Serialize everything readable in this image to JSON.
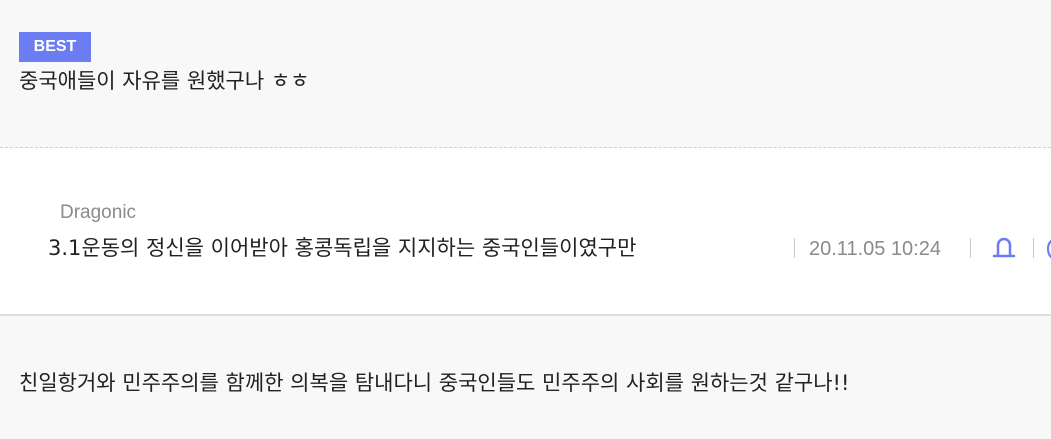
{
  "best_comment": {
    "badge": "BEST",
    "text": "중국애들이 자유를 원했구나 ㅎㅎ"
  },
  "reply": {
    "author": "Dragonic",
    "text": "3.1운동의 정신을 이어받아 홍콩독립을 지지하는 중국인들이였구만",
    "date": "20.11.05 10:24",
    "icons": [
      "report-icon",
      "more-icon"
    ],
    "accent_color": "#6c7cf3"
  },
  "comment": {
    "text": "친일항거와 민주주의를 함께한 의복을 탐내다니 중국인들도 민주주의 사회를 원하는것 같구나!!"
  }
}
